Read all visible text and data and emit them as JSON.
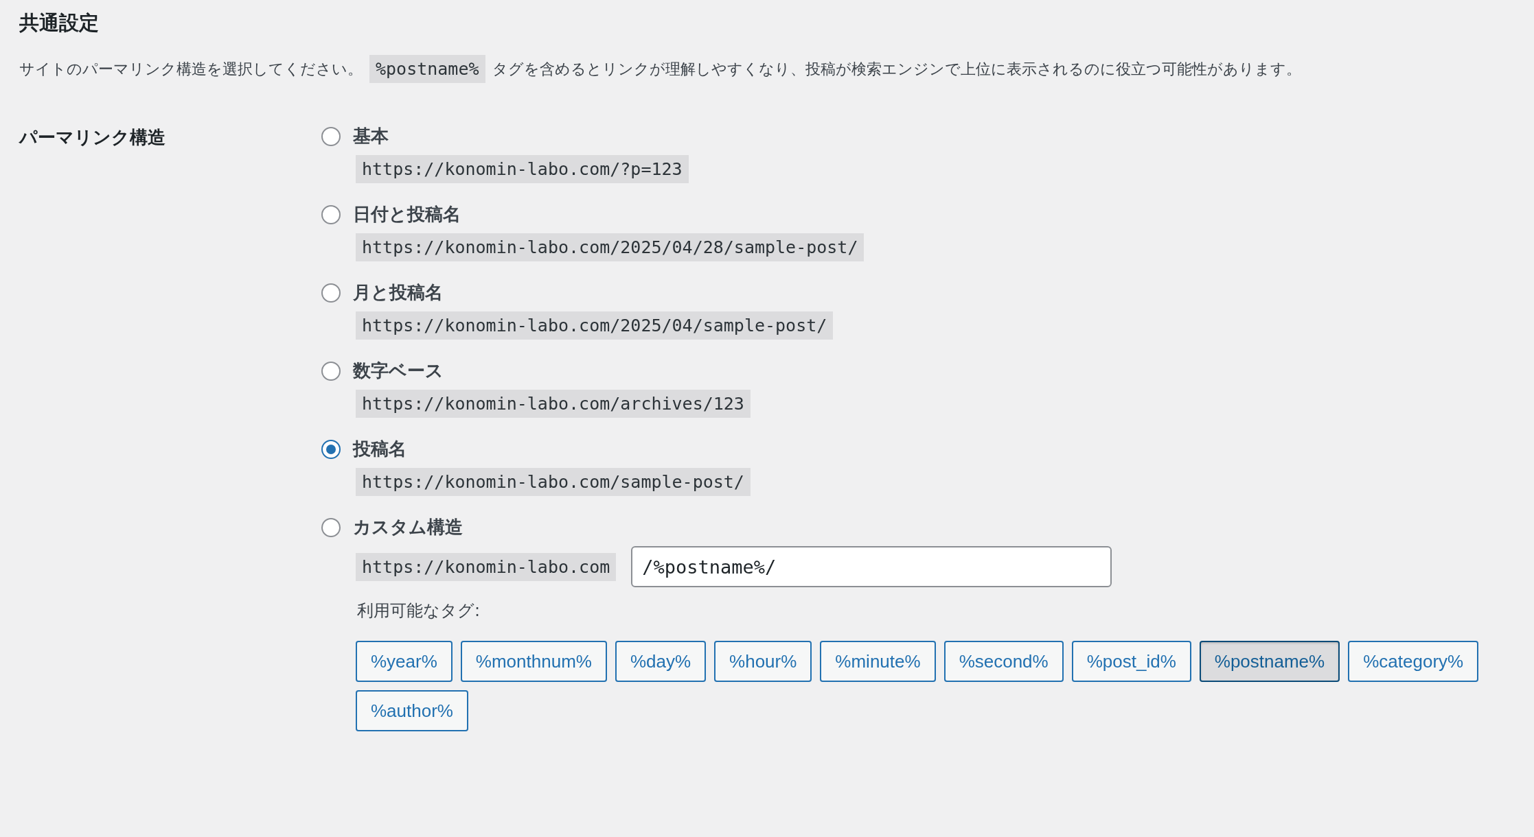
{
  "section_title": "共通設定",
  "description": {
    "before": "サイトのパーマリンク構造を選択してください。",
    "code": "%postname%",
    "after": "タグを含めるとリンクが理解しやすくなり、投稿が検索エンジンで上位に表示されるのに役立つ可能性があります。"
  },
  "field_label": "パーマリンク構造",
  "options": [
    {
      "label": "基本",
      "example": "https://konomin-labo.com/?p=123",
      "selected": false
    },
    {
      "label": "日付と投稿名",
      "example": "https://konomin-labo.com/2025/04/28/sample-post/",
      "selected": false
    },
    {
      "label": "月と投稿名",
      "example": "https://konomin-labo.com/2025/04/sample-post/",
      "selected": false
    },
    {
      "label": "数字ベース",
      "example": "https://konomin-labo.com/archives/123",
      "selected": false
    },
    {
      "label": "投稿名",
      "example": "https://konomin-labo.com/sample-post/",
      "selected": true
    },
    {
      "label": "カスタム構造",
      "selected": false
    }
  ],
  "custom": {
    "prefix": "https://konomin-labo.com",
    "value": "/%postname%/",
    "tags_label": "利用可能なタグ:"
  },
  "tags": [
    {
      "label": "%year%",
      "selected": false
    },
    {
      "label": "%monthnum%",
      "selected": false
    },
    {
      "label": "%day%",
      "selected": false
    },
    {
      "label": "%hour%",
      "selected": false
    },
    {
      "label": "%minute%",
      "selected": false
    },
    {
      "label": "%second%",
      "selected": false
    },
    {
      "label": "%post_id%",
      "selected": false
    },
    {
      "label": "%postname%",
      "selected": true
    },
    {
      "label": "%category%",
      "selected": false
    },
    {
      "label": "%author%",
      "selected": false
    }
  ]
}
